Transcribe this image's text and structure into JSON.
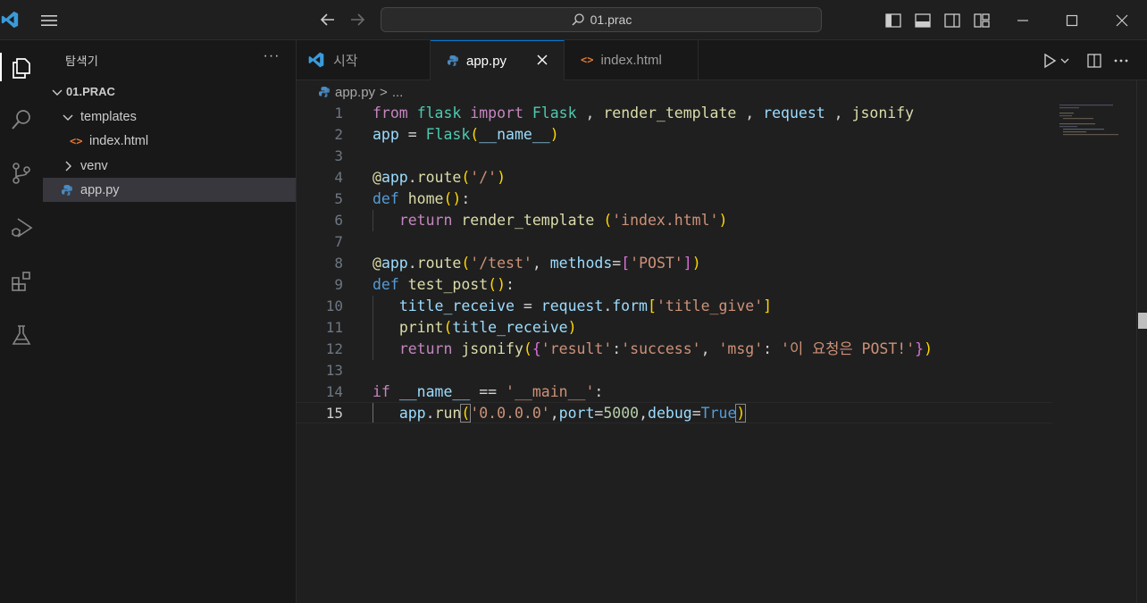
{
  "window": {
    "search_text": "01.prac",
    "accent": "#0078d4"
  },
  "sidebar": {
    "title": "탐색기",
    "more": "···",
    "root_folder": "01.PRAC",
    "items": [
      {
        "label": "templates",
        "kind": "folder",
        "expanded": true
      },
      {
        "label": "index.html",
        "kind": "html-file"
      },
      {
        "label": "venv",
        "kind": "folder",
        "expanded": false
      },
      {
        "label": "app.py",
        "kind": "python-file",
        "selected": true
      }
    ]
  },
  "tabs": [
    {
      "label": "시작",
      "icon": "vscode-icon",
      "active": false
    },
    {
      "label": "app.py",
      "icon": "python-icon",
      "active": true
    },
    {
      "label": "index.html",
      "icon": "html-icon",
      "active": false
    }
  ],
  "breadcrumb": {
    "file": "app.py",
    "separator": ">",
    "rest": "..."
  },
  "editor": {
    "current_line": 15,
    "line_numbers": [
      "1",
      "2",
      "3",
      "4",
      "5",
      "6",
      "7",
      "8",
      "9",
      "10",
      "11",
      "12",
      "13",
      "14",
      "15"
    ]
  }
}
